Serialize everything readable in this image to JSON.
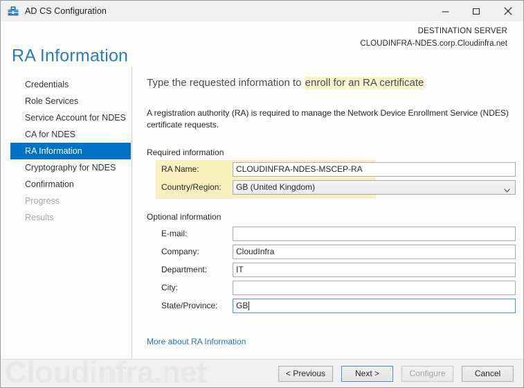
{
  "window": {
    "title": "AD CS Configuration",
    "icon": "toolbox-icon",
    "minimize_label": "Minimize",
    "maximize_label": "Maximize",
    "close_label": "Close"
  },
  "header": {
    "page_title": "RA Information",
    "destination_label": "DESTINATION SERVER",
    "destination_server": "CLOUDINFRA-NDES.corp.Cloudinfra.net",
    "title_color": "#2b7cb8"
  },
  "sidebar": {
    "items": [
      {
        "label": "Credentials",
        "state": "normal"
      },
      {
        "label": "Role Services",
        "state": "normal"
      },
      {
        "label": "Service Account for NDES",
        "state": "normal"
      },
      {
        "label": "CA for NDES",
        "state": "normal"
      },
      {
        "label": "RA Information",
        "state": "selected"
      },
      {
        "label": "Cryptography for NDES",
        "state": "normal"
      },
      {
        "label": "Confirmation",
        "state": "normal"
      },
      {
        "label": "Progress",
        "state": "disabled"
      },
      {
        "label": "Results",
        "state": "disabled"
      }
    ],
    "selected_color": "#0072c6"
  },
  "main": {
    "instruction_prefix": "Type the requested information to ",
    "instruction_highlight": "enroll for an RA certificate",
    "highlight_color": "#fbf5cd",
    "description": "A registration authority (RA) is required to manage the Network Device Enrollment Service (NDES) certificate requests.",
    "required_section_label": "Required information",
    "optional_section_label": "Optional information",
    "required_fields": [
      {
        "label": "RA Name:",
        "value": "CLOUDINFRA-NDES-MSCEP-RA",
        "placeholder": "",
        "type": "textbox",
        "focused": false
      },
      {
        "label": "Country/Region:",
        "value": "GB (United Kingdom)",
        "type": "combobox",
        "focused": false
      }
    ],
    "optional_fields": [
      {
        "label": "E-mail:",
        "value": "",
        "placeholder": "",
        "type": "textbox",
        "focused": false
      },
      {
        "label": "Company:",
        "value": "CloudInfra",
        "placeholder": "",
        "type": "textbox",
        "focused": false
      },
      {
        "label": "Department:",
        "value": "IT",
        "placeholder": "",
        "type": "textbox",
        "focused": false
      },
      {
        "label": "City:",
        "value": "",
        "placeholder": "",
        "type": "textbox",
        "focused": false
      },
      {
        "label": "State/Province:",
        "value": "GB",
        "placeholder": "",
        "type": "textbox",
        "focused": true
      }
    ],
    "more_link": "More about RA Information",
    "required_highlight_color": "#faf0bd"
  },
  "footer": {
    "watermark": "Cloudinfra.net",
    "buttons": [
      {
        "label": "< Previous",
        "state": "normal"
      },
      {
        "label": "Next >",
        "state": "focused"
      },
      {
        "label": "Configure",
        "state": "disabled"
      },
      {
        "label": "Cancel",
        "state": "normal"
      }
    ]
  }
}
